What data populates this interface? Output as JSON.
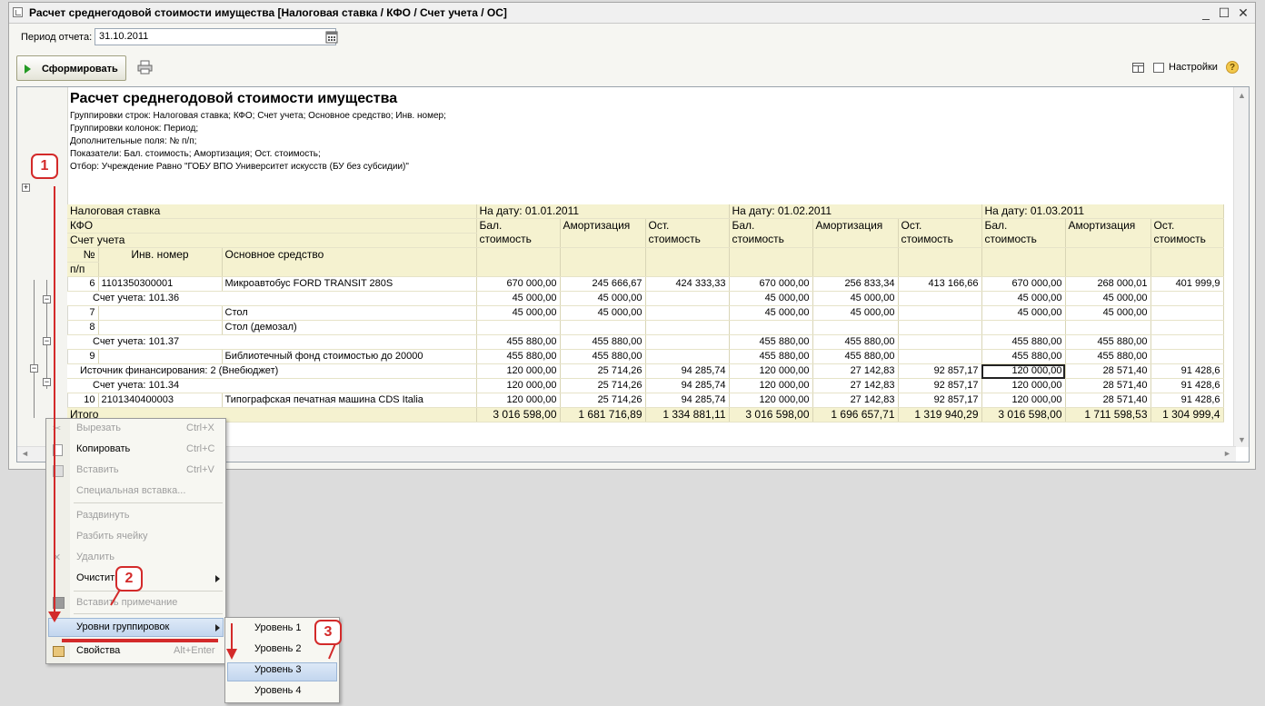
{
  "window": {
    "title": "Расчет среднегодовой стоимости имущества [Налоговая ставка / КФО / Счет учета / ОС]",
    "minimize": "_",
    "maximize": "☐",
    "close": "✕"
  },
  "toolbar": {
    "period_label": "Период отчета:",
    "period_value": "31.10.2011",
    "generate_label": "Сформировать",
    "settings_label": "Настройки",
    "help_label": "?"
  },
  "report": {
    "title": "Расчет среднегодовой стоимости имущества",
    "info": [
      "Группировки строк: Налоговая ставка; КФО; Счет учета; Основное средство; Инв. номер;",
      "Группировки колонок: Период;",
      "Дополнительные поля: № п/п;",
      "Показатели: Бал. стоимость; Амортизация; Ост. стоимость;",
      "Отбор: Учреждение Равно \"ГОБУ ВПО Университет искусств (БУ без субсидии)\""
    ],
    "header": {
      "tax_rate": "Налоговая ставка",
      "kfo": "КФО",
      "account": "Счет учета",
      "num": "№",
      "num2": "п/п",
      "inv": "Инв. номер",
      "asset": "Основное средство",
      "dates": [
        "На дату: 01.01.2011",
        "На дату: 01.02.2011",
        "На дату: 01.03.2011"
      ],
      "bal1": "Бал.",
      "bal2": "стоимость",
      "amort": "Амортизация",
      "rest1": "Ост.",
      "rest2": "стоимость"
    },
    "rows": [
      {
        "n": "6",
        "inv": "1101350300001",
        "name": "Микроавтобус FORD TRANSIT 280S",
        "v": [
          "670 000,00",
          "245 666,67",
          "424 333,33",
          "670 000,00",
          "256 833,34",
          "413 166,66",
          "670 000,00",
          "268 000,01",
          "401 999,9"
        ]
      },
      {
        "group": "Счет учета: 101.36",
        "indent": 2,
        "v": [
          "45 000,00",
          "45 000,00",
          "",
          "45 000,00",
          "45 000,00",
          "",
          "45 000,00",
          "45 000,00",
          ""
        ]
      },
      {
        "n": "7",
        "inv": "",
        "name": "Стол",
        "v": [
          "45 000,00",
          "45 000,00",
          "",
          "45 000,00",
          "45 000,00",
          "",
          "45 000,00",
          "45 000,00",
          ""
        ]
      },
      {
        "n": "8",
        "inv": "",
        "name": "Стол (демозал)",
        "v": [
          "",
          "",
          "",
          "",
          "",
          "",
          "",
          "",
          ""
        ]
      },
      {
        "group": "Счет учета: 101.37",
        "indent": 2,
        "v": [
          "455 880,00",
          "455 880,00",
          "",
          "455 880,00",
          "455 880,00",
          "",
          "455 880,00",
          "455 880,00",
          ""
        ]
      },
      {
        "n": "9",
        "inv": "",
        "name": "Библиотечный фонд стоимостью до 20000",
        "v": [
          "455 880,00",
          "455 880,00",
          "",
          "455 880,00",
          "455 880,00",
          "",
          "455 880,00",
          "455 880,00",
          ""
        ]
      },
      {
        "group": "Источник финансирования: 2 (Внебюджет)",
        "indent": 1,
        "v": [
          "120 000,00",
          "25 714,26",
          "94 285,74",
          "120 000,00",
          "27 142,83",
          "92 857,17",
          "120 000,00",
          "28 571,40",
          "91 428,6"
        ]
      },
      {
        "group": "Счет учета: 101.34",
        "indent": 2,
        "v": [
          "120 000,00",
          "25 714,26",
          "94 285,74",
          "120 000,00",
          "27 142,83",
          "92 857,17",
          "120 000,00",
          "28 571,40",
          "91 428,6"
        ]
      },
      {
        "n": "10",
        "inv": "2101340400003",
        "name": "Типографская печатная машина CDS Italia",
        "v": [
          "120 000,00",
          "25 714,26",
          "94 285,74",
          "120 000,00",
          "27 142,83",
          "92 857,17",
          "120 000,00",
          "28 571,40",
          "91 428,6"
        ]
      }
    ],
    "total": {
      "label": "Итого",
      "v": [
        "3 016 598,00",
        "1 681 716,89",
        "1 334 881,11",
        "3 016 598,00",
        "1 696 657,71",
        "1 319 940,29",
        "3 016 598,00",
        "1 711 598,53",
        "1 304 999,4"
      ]
    }
  },
  "context_menu": {
    "cut": "Вырезать",
    "cut_sc": "Ctrl+X",
    "copy": "Копировать",
    "copy_sc": "Ctrl+C",
    "paste": "Вставить",
    "paste_sc": "Ctrl+V",
    "paste_special": "Специальная вставка...",
    "unmerge": "Раздвинуть",
    "split": "Разбить ячейку",
    "delete": "Удалить",
    "clear": "Очистить",
    "insert_note": "Вставить примечание",
    "group_levels": "Уровни группировок",
    "properties": "Свойства",
    "properties_sc": "Alt+Enter"
  },
  "submenu": [
    "Уровень 1",
    "Уровень 2",
    "Уровень 3",
    "Уровень 4"
  ],
  "callouts": [
    "1",
    "2",
    "3"
  ],
  "colors": {
    "header_bg": "#f5f2d0",
    "callout": "#d32a2a",
    "highlight": "#c2d6ee"
  }
}
